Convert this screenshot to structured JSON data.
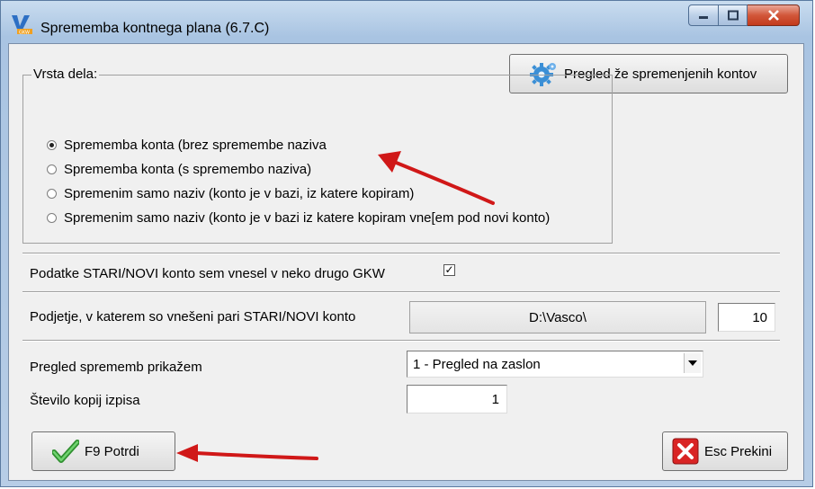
{
  "window": {
    "title": "Sprememba kontnega plana  (6.7.C)"
  },
  "toolbar": {
    "review_button_label": "Pregled že spremenjenih kontov"
  },
  "work_type": {
    "group_label": "Vrsta dela:",
    "options": [
      {
        "label": "Sprememba konta (brez spremembe naziva",
        "selected": true
      },
      {
        "label": "Sprememba konta (s spremembo naziva)",
        "selected": false
      },
      {
        "label": "Spremenim samo naziv (konto je v bazi, iz katere kopiram)",
        "selected": false
      },
      {
        "label": "Spremenim samo naziv (konto je v bazi iz katere kopiram vne[em pod novi konto)",
        "selected": false
      }
    ]
  },
  "other_gkw": {
    "label": "Podatke STARI/NOVI konto sem vnesel v neko drugo GKW",
    "checked": true,
    "check_mark": "✓"
  },
  "company": {
    "label": "Podjetje, v katerem so vnešeni pari STARI/NOVI konto",
    "path": "D:\\Vasco\\",
    "number": "10"
  },
  "review_display": {
    "label": "Pregled sprememb prikažem",
    "selected": "1 - Pregled na zaslon"
  },
  "copies": {
    "label": "Število kopij izpisa",
    "value": "1"
  },
  "actions": {
    "confirm_label": "F9 Potrdi",
    "cancel_label": "Esc Prekini"
  },
  "colors": {
    "annotation_arrow": "#d01818",
    "confirm_icon": "#3aa83a",
    "cancel_icon": "#d92424",
    "gear_icon": "#3b8fd6"
  }
}
